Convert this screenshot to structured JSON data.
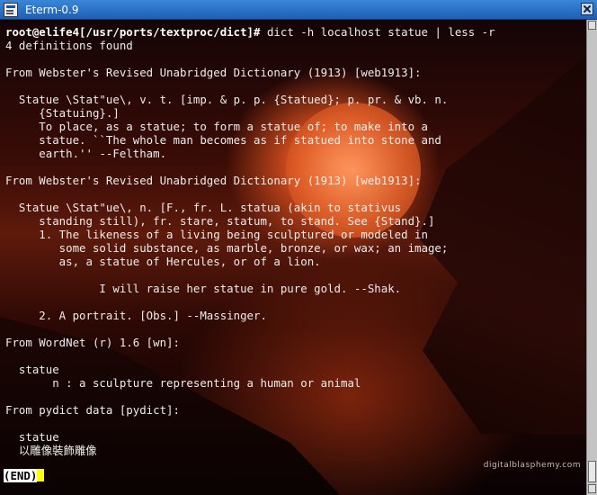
{
  "window": {
    "title": "Eterm-0.9",
    "icon": "terminal-icon",
    "close_icon": "close-icon"
  },
  "terminal": {
    "prompt": "root@elife4[/usr/ports/textproc/dict]#",
    "command": " dict -h localhost statue | less -r",
    "lines": [
      "4 definitions found",
      "",
      "From Webster's Revised Unabridged Dictionary (1913) [web1913]:",
      "",
      "  Statue \\Stat\"ue\\, v. t. [imp. & p. p. {Statued}; p. pr. & vb. n.",
      "     {Statuing}.]",
      "     To place, as a statue; to form a statue of; to make into a",
      "     statue. ``The whole man becomes as if statued into stone and",
      "     earth.'' --Feltham.",
      "",
      "From Webster's Revised Unabridged Dictionary (1913) [web1913]:",
      "",
      "  Statue \\Stat\"ue\\, n. [F., fr. L. statua (akin to stativus",
      "     standing still), fr. stare, statum, to stand. See {Stand}.]",
      "     1. The likeness of a living being sculptured or modeled in",
      "        some solid substance, as marble, bronze, or wax; an image;",
      "        as, a statue of Hercules, or of a lion.",
      "",
      "              I will raise her statue in pure gold. --Shak.",
      "",
      "     2. A portrait. [Obs.] --Massinger.",
      "",
      "From WordNet (r) 1.6 [wn]:",
      "",
      "  statue",
      "       n : a sculpture representing a human or animal",
      "",
      "From pydict data [pydict]:",
      "",
      "  statue",
      "  以雕像裝飾雕像"
    ],
    "status": "(END)",
    "watermark": "digitalblasphemy.com"
  },
  "colors": {
    "titlebar": "#2a72c8",
    "text": "#ededed",
    "cursor": "#ffff00"
  }
}
